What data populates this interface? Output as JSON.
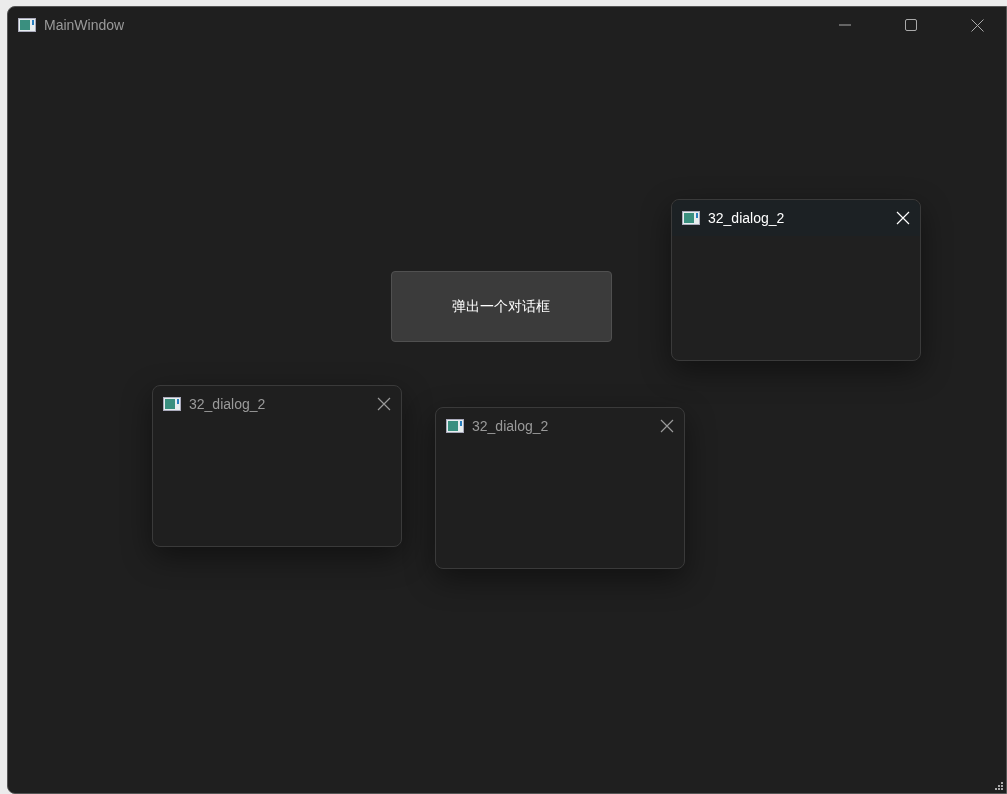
{
  "window": {
    "title": "MainWindow"
  },
  "button": {
    "label": "弹出一个对话框"
  },
  "dialogs": [
    {
      "title": "32_dialog_2",
      "active": false
    },
    {
      "title": "32_dialog_2",
      "active": false
    },
    {
      "title": "32_dialog_2",
      "active": true
    }
  ]
}
